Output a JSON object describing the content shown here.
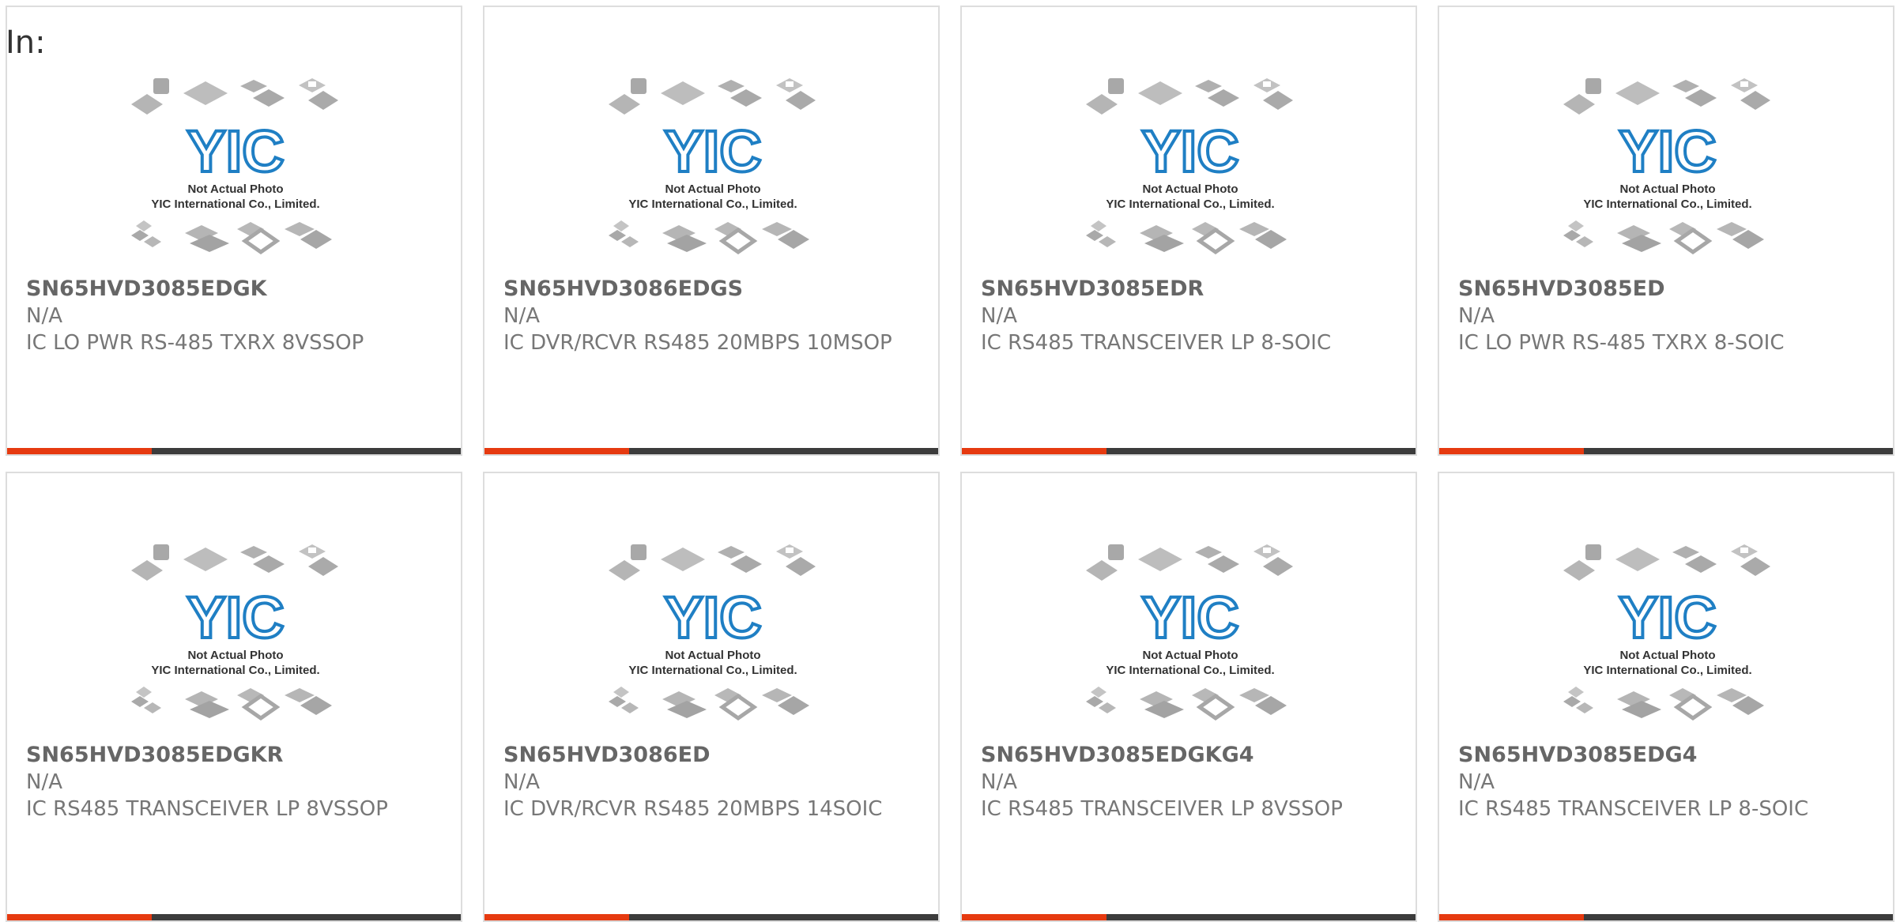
{
  "header": {
    "label": "In:"
  },
  "placeholder_image": {
    "logo_text": "YIC",
    "line1": "Not Actual Photo",
    "line2": "YIC International Co., Limited."
  },
  "colors": {
    "accent": "#e63a10",
    "bar": "#3c3c3c",
    "logo_blue": "#1f7fc4"
  },
  "products": [
    {
      "part_number": "SN65HVD3085EDGK",
      "manufacturer": "N/A",
      "description": "IC LO PWR RS-485 TXRX 8VSSOP"
    },
    {
      "part_number": "SN65HVD3086EDGS",
      "manufacturer": "N/A",
      "description": "IC DVR/RCVR RS485 20MBPS 10MSOP"
    },
    {
      "part_number": "SN65HVD3085EDR",
      "manufacturer": "N/A",
      "description": "IC RS485 TRANSCEIVER LP 8-SOIC"
    },
    {
      "part_number": "SN65HVD3085ED",
      "manufacturer": "N/A",
      "description": "IC LO PWR RS-485 TXRX 8-SOIC"
    },
    {
      "part_number": "SN65HVD3085EDGKR",
      "manufacturer": "N/A",
      "description": "IC RS485 TRANSCEIVER LP 8VSSOP"
    },
    {
      "part_number": "SN65HVD3086ED",
      "manufacturer": "N/A",
      "description": "IC DVR/RCVR RS485 20MBPS 14SOIC"
    },
    {
      "part_number": "SN65HVD3085EDGKG4",
      "manufacturer": "N/A",
      "description": "IC RS485 TRANSCEIVER LP 8VSSOP"
    },
    {
      "part_number": "SN65HVD3085EDG4",
      "manufacturer": "N/A",
      "description": "IC RS485 TRANSCEIVER LP 8-SOIC"
    }
  ]
}
